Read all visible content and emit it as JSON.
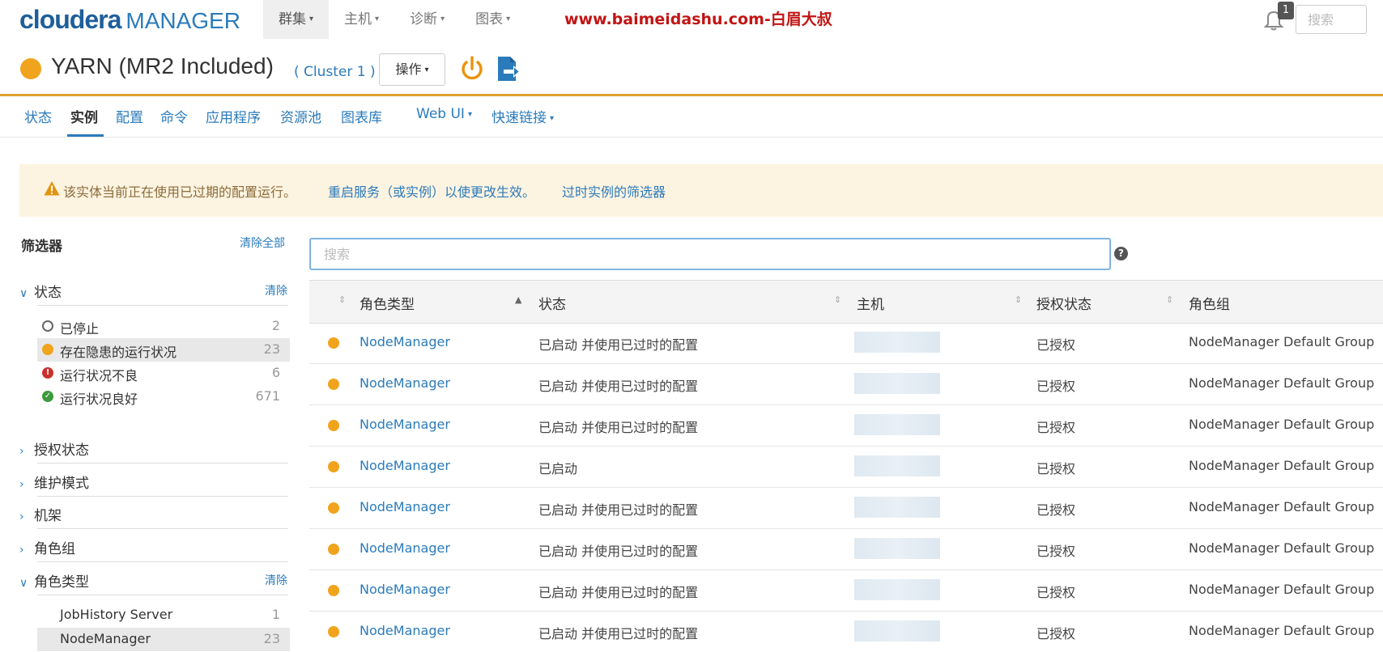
{
  "brand": {
    "name_a": "cloudera",
    "name_b": "MANAGER"
  },
  "topnav": [
    {
      "label": "群集"
    },
    {
      "label": "主机"
    },
    {
      "label": "诊断"
    },
    {
      "label": "图表"
    }
  ],
  "watermark": "www.baimeidashu.com-白眉大叔",
  "notifications": {
    "count": "1"
  },
  "top_search": {
    "placeholder": "搜索"
  },
  "service": {
    "title": "YARN (MR2 Included)",
    "cluster": "( Cluster 1 )",
    "actions_label": "操作",
    "status_color": "#f0a31d"
  },
  "subnav": {
    "tabs": [
      "状态",
      "实例",
      "配置",
      "命令",
      "应用程序",
      "资源池",
      "图表库"
    ],
    "web_ui": "Web UI",
    "quick_links": "快速链接",
    "active_tab": "实例"
  },
  "alert": {
    "message": "该实体当前正在使用已过期的配置运行。",
    "link_restart": "重启服务（或实例）以使更改生效。",
    "link_filter": "过时实例的筛选器"
  },
  "filters": {
    "title": "筛选器",
    "clear_all": "清除全部",
    "clear": "清除",
    "status_section": "状态",
    "status_options": [
      {
        "label": "已停止",
        "count": "2",
        "icon": "stopped-icon"
      },
      {
        "label": "存在隐患的运行状况",
        "count": "23",
        "icon": "concerning-health-icon"
      },
      {
        "label": "运行状况不良",
        "count": "6",
        "icon": "bad-health-icon"
      },
      {
        "label": "运行状况良好",
        "count": "671",
        "icon": "good-health-icon"
      }
    ],
    "collapsed_sections": [
      "授权状态",
      "维护模式",
      "机架",
      "角色组"
    ],
    "role_type_section": "角色类型",
    "role_type_options": [
      {
        "label": "JobHistory Server",
        "count": "1"
      },
      {
        "label": "NodeManager",
        "count": "23"
      }
    ]
  },
  "table": {
    "search_placeholder": "搜索",
    "columns": [
      "角色类型",
      "状态",
      "主机",
      "授权状态",
      "角色组"
    ],
    "rows": [
      {
        "role": "NodeManager",
        "status": "已启动 并使用已过时的配置",
        "auth": "已授权",
        "group": "NodeManager Default Group"
      },
      {
        "role": "NodeManager",
        "status": "已启动 并使用已过时的配置",
        "auth": "已授权",
        "group": "NodeManager Default Group"
      },
      {
        "role": "NodeManager",
        "status": "已启动 并使用已过时的配置",
        "auth": "已授权",
        "group": "NodeManager Default Group"
      },
      {
        "role": "NodeManager",
        "status": "已启动",
        "auth": "已授权",
        "group": "NodeManager Default Group"
      },
      {
        "role": "NodeManager",
        "status": "已启动 并使用已过时的配置",
        "auth": "已授权",
        "group": "NodeManager Default Group"
      },
      {
        "role": "NodeManager",
        "status": "已启动 并使用已过时的配置",
        "auth": "已授权",
        "group": "NodeManager Default Group"
      },
      {
        "role": "NodeManager",
        "status": "已启动 并使用已过时的配置",
        "auth": "已授权",
        "group": "NodeManager Default Group"
      },
      {
        "role": "NodeManager",
        "status": "已启动 并使用已过时的配置",
        "auth": "已授权",
        "group": "NodeManager Default Group"
      }
    ]
  },
  "colors": {
    "brand_blue": "#1e5f99",
    "link_blue": "#2b7bbb",
    "warning_orange": "#f0a31d",
    "alert_bg": "#fdf3e1"
  }
}
